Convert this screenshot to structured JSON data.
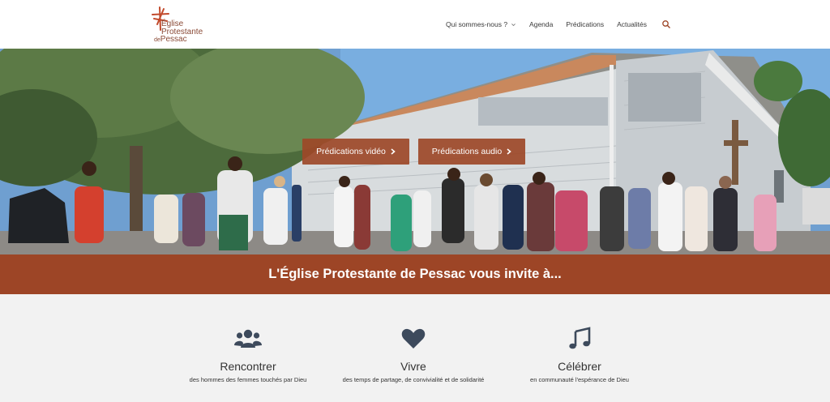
{
  "site": {
    "logo_lines": [
      "Église",
      "Protestante",
      "de",
      "Pessac"
    ]
  },
  "nav": {
    "items": [
      {
        "label": "Qui sommes-nous ?",
        "has_dropdown": true
      },
      {
        "label": "Agenda"
      },
      {
        "label": "Prédications"
      },
      {
        "label": "Actualités"
      }
    ],
    "search_icon": "search-icon"
  },
  "hero": {
    "buttons": [
      {
        "label": "Prédications vidéo",
        "icon": "chevron-right-icon"
      },
      {
        "label": "Prédications audio",
        "icon": "chevron-right-icon"
      }
    ]
  },
  "banner": {
    "text": "L'Église Protestante de Pessac vous invite à..."
  },
  "features": [
    {
      "icon": "users-icon",
      "title": "Rencontrer",
      "subtitle": "des hommes des femmes touchés par Dieu"
    },
    {
      "icon": "heart-icon",
      "title": "Vivre",
      "subtitle": "des temps de partage, de convivialité et de solidarité"
    },
    {
      "icon": "music-note-icon",
      "title": "Célébrer",
      "subtitle": "en communauté l'espérance de Dieu"
    }
  ],
  "colors": {
    "brand": "#9d4526",
    "logo": "#8a4a36",
    "features_bg": "#f2f2f2"
  }
}
